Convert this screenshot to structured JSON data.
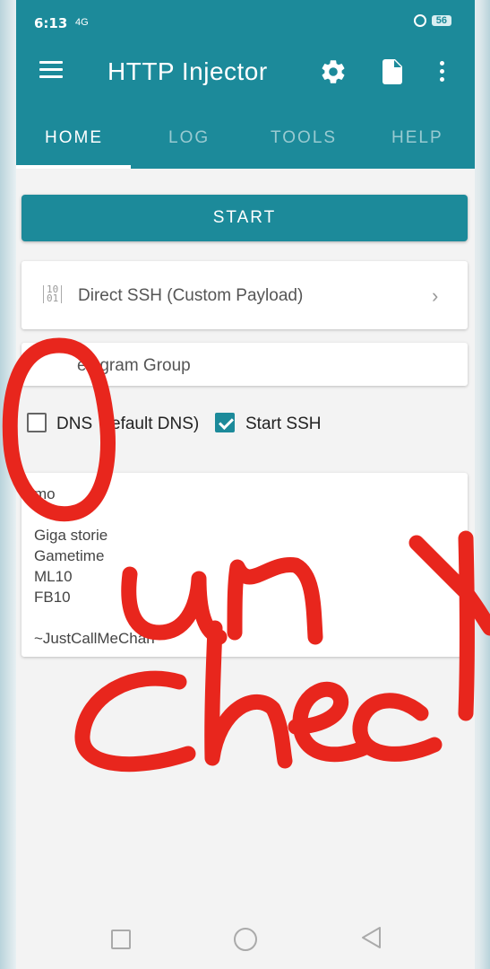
{
  "statusbar": {
    "time": "6:13",
    "signal": "4G",
    "battery": "56"
  },
  "appbar": {
    "title": "HTTP Injector"
  },
  "tabs": [
    {
      "label": "HOME",
      "active": true
    },
    {
      "label": "LOG",
      "active": false
    },
    {
      "label": "TOOLS",
      "active": false
    },
    {
      "label": "HELP",
      "active": false
    }
  ],
  "start_button": {
    "label": "START"
  },
  "mode": {
    "label": "Direct SSH (Custom Payload)",
    "icon": "binary-icon"
  },
  "telegram": {
    "label": "elegram Group"
  },
  "options": [
    {
      "label": "DNS",
      "label_rest": "efault DNS)",
      "checked": false
    },
    {
      "label": "Start SSH",
      "checked": true
    }
  ],
  "notes": {
    "header": "mo",
    "lines": [
      "Giga storie",
      "Gametime",
      "ML10",
      "FB10",
      "",
      "~JustCallMeChan"
    ]
  },
  "annotation": {
    "text": "O un check",
    "color": "#e8261d"
  },
  "colors": {
    "primary": "#1c8a9a",
    "background": "#f3f3f3"
  }
}
